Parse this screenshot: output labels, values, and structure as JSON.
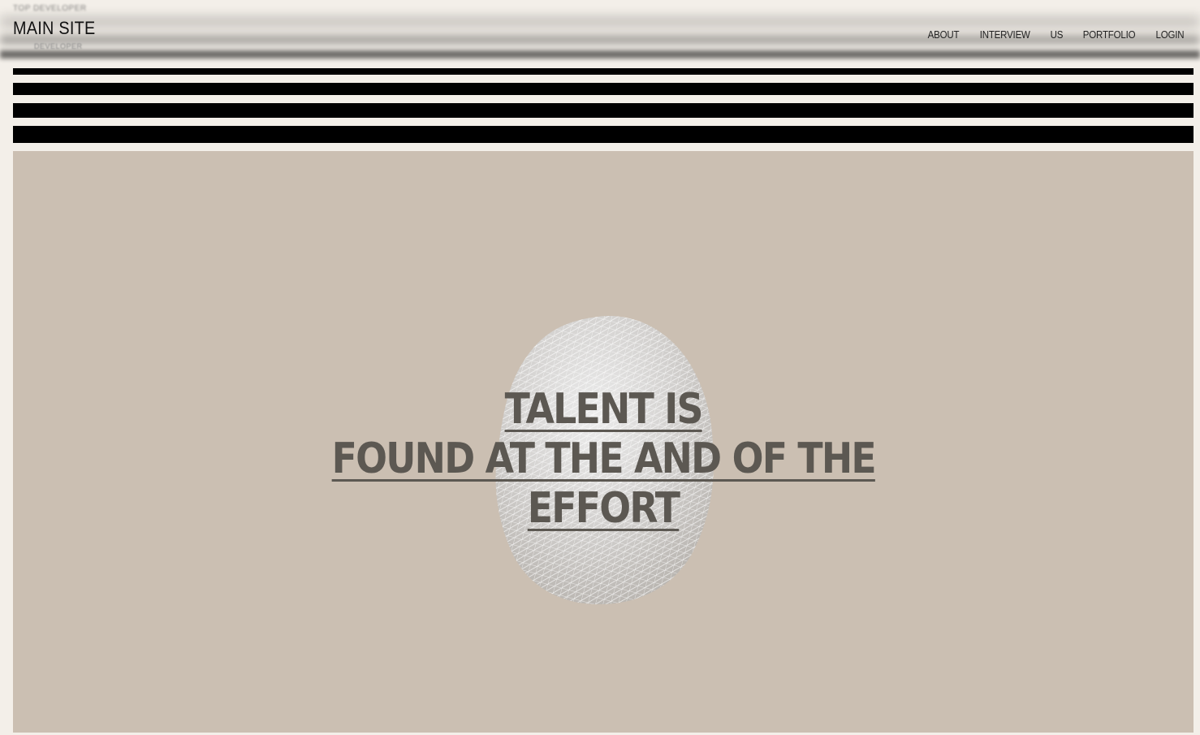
{
  "header": {
    "top_text": "TOP DEVELOPER",
    "logo": "MAIN SITE",
    "logo_sub": "DEVELOPER",
    "nav": [
      {
        "label": "ABOUT"
      },
      {
        "label": "INTERVIEW"
      },
      {
        "label": "US"
      },
      {
        "label": "PORTFOLIO"
      },
      {
        "label": "LOGIN"
      }
    ]
  },
  "hero": {
    "headline_line1": "TALENT IS",
    "headline_line2": "FOUND AT THE AND OF THE",
    "headline_line3": "EFFORT",
    "background_color": "#cbbfb2",
    "text_color": "#5c5852",
    "graphic": "wireframe-sphere"
  },
  "colors": {
    "page_background": "#f3efe9",
    "stripes": "#000000"
  }
}
